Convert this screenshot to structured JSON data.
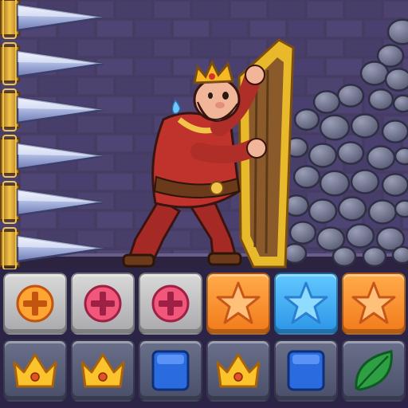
{
  "scene": {
    "spikes_count": 6,
    "colors": {
      "brick": "#4a3f68",
      "brick_dark": "#3a3156",
      "mortar": "#2e2646",
      "spike_gold": "#d9a62a",
      "spike_steel": "#b9c4e6",
      "rock": "#6f7189",
      "door_gold": "#e8b92a",
      "door_wood": "#8a5a2b",
      "king_robe": "#b8302a",
      "crown": "#f6b823"
    }
  },
  "board": {
    "rows": [
      [
        {
          "tile": "grey",
          "icon": "plus-orange-icon"
        },
        {
          "tile": "grey",
          "icon": "plus-pink-icon"
        },
        {
          "tile": "grey",
          "icon": "plus-pink-icon"
        },
        {
          "tile": "orange",
          "icon": "star-orange-icon"
        },
        {
          "tile": "blue",
          "icon": "star-blue-icon"
        },
        {
          "tile": "orange",
          "icon": "star-orange-icon"
        }
      ],
      [
        {
          "tile": "dark",
          "icon": "crown-icon"
        },
        {
          "tile": "dark",
          "icon": "crown-icon"
        },
        {
          "tile": "dark",
          "icon": "blue-cube-icon"
        },
        {
          "tile": "dark",
          "icon": "crown-icon"
        },
        {
          "tile": "dark",
          "icon": "blue-cube-icon"
        },
        {
          "tile": "dark",
          "icon": "leaf-icon"
        }
      ]
    ]
  }
}
